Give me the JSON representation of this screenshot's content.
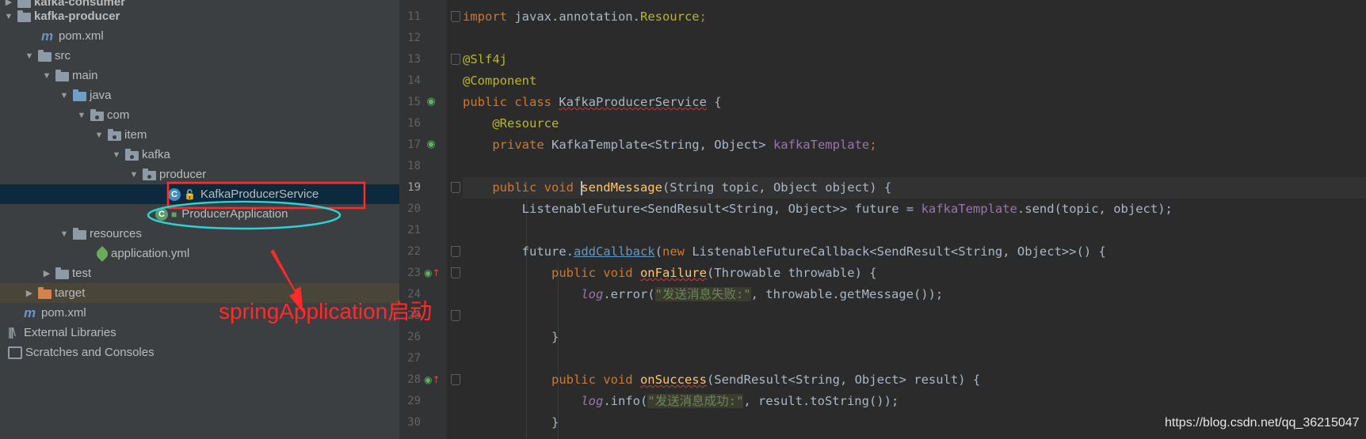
{
  "project_tree": {
    "items": [
      {
        "label": "kafka-consumer",
        "indent": 1,
        "icon": "module-folder-icon",
        "chevron": "right"
      },
      {
        "label": "kafka-producer",
        "indent": 1,
        "icon": "module-folder-icon",
        "chevron": "down"
      },
      {
        "label": "pom.xml",
        "indent": 3,
        "icon": "maven-icon"
      },
      {
        "label": "src",
        "indent": 2,
        "icon": "folder-icon",
        "chevron": "down"
      },
      {
        "label": "main",
        "indent": 3,
        "icon": "folder-icon",
        "chevron": "down"
      },
      {
        "label": "java",
        "indent": 4,
        "icon": "source-folder-icon",
        "chevron": "down"
      },
      {
        "label": "com",
        "indent": 5,
        "icon": "package-icon",
        "chevron": "down"
      },
      {
        "label": "item",
        "indent": 6,
        "icon": "package-icon",
        "chevron": "down"
      },
      {
        "label": "kafka",
        "indent": 7,
        "icon": "package-icon",
        "chevron": "down"
      },
      {
        "label": "producer",
        "indent": 8,
        "icon": "package-icon",
        "chevron": "down"
      },
      {
        "label": "KafkaProducerService",
        "indent": 10,
        "icon": "class-icon"
      },
      {
        "label": "ProducerApplication",
        "indent": 9,
        "icon": "spring-boot-class-icon"
      },
      {
        "label": "resources",
        "indent": 4,
        "icon": "resources-folder-icon",
        "chevron": "down"
      },
      {
        "label": "application.yml",
        "indent": 6,
        "icon": "spring-yml-icon"
      },
      {
        "label": "test",
        "indent": 3,
        "icon": "folder-icon",
        "chevron": "right"
      },
      {
        "label": "target",
        "indent": 2,
        "icon": "excluded-folder-icon",
        "chevron": "right"
      },
      {
        "label": "pom.xml",
        "indent": 1,
        "icon": "maven-icon"
      },
      {
        "label": "External Libraries",
        "indent": 0,
        "icon": "libraries-icon",
        "chevron": "right"
      },
      {
        "label": "Scratches and Consoles",
        "indent": 0,
        "icon": "scratches-icon",
        "chevron": "right"
      }
    ]
  },
  "editor": {
    "line_numbers": [
      "11",
      "12",
      "13",
      "14",
      "15",
      "16",
      "17",
      "18",
      "19",
      "20",
      "21",
      "22",
      "23",
      "24",
      "25",
      "26",
      "27",
      "28",
      "29",
      "30"
    ],
    "current_line": "19",
    "code": {
      "l11_kw": "import",
      "l11_rest": " javax.annotation.",
      "l11_cls": "Resource",
      "l11_semi": ";",
      "l13_an": "@Slf4j",
      "l14_an": "@Component",
      "l15_kw": "public class ",
      "l15_cls": "KafkaProducerService",
      "l15_rest": " {",
      "l16_an": "@Resource",
      "l17_kw": "private ",
      "l17_type": "KafkaTemplate<String, Object> ",
      "l17_fld": "kafkaTemplate",
      "l17_semi": ";",
      "l19_kw": "public void ",
      "l19_fn": "sendMessage",
      "l19_rest": "(String topic, Object object) {",
      "l20_a": "ListenableFuture<SendResult<String, Object>> future = ",
      "l20_fld": "kafkaTemplate",
      "l20_b": ".send(topic, object);",
      "l22_a": "future.",
      "l22_m": "addCallback",
      "l22_b": "(",
      "l22_kw": "new ",
      "l22_c": "ListenableFutureCallback<SendResult<String, Object>>() {",
      "l23_kw": "public void ",
      "l23_fn": "onFailure",
      "l23_rest": "(Throwable throwable) {",
      "l24_log": "log",
      "l24_a": ".error(",
      "l24_str": "\"发送消息失败:\"",
      "l24_b": ", throwable.getMessage());",
      "l26": "}",
      "l28_kw": "public void ",
      "l28_fn": "onSuccess",
      "l28_rest": "(SendResult<String, Object> result) {",
      "l29_log": "log",
      "l29_a": ".info(",
      "l29_str": "\"发送消息成功:\"",
      "l29_b": ", result.toString());",
      "l30": "}"
    }
  },
  "annotation": {
    "label": "springApplication启动",
    "color": "#ff2a2a",
    "ellipse_color": "#2ad4d4"
  },
  "watermark": "https://blog.csdn.net/qq_36215047"
}
